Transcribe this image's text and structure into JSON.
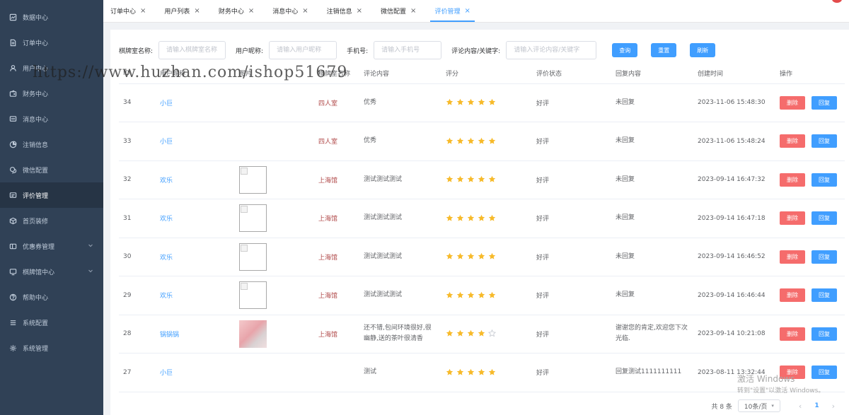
{
  "sidebar": {
    "items": [
      {
        "label": "数据中心",
        "icon": "dashboard-icon"
      },
      {
        "label": "订单中心",
        "icon": "document-icon"
      },
      {
        "label": "用户中心",
        "icon": "user-icon"
      },
      {
        "label": "财务中心",
        "icon": "wallet-icon"
      },
      {
        "label": "消息中心",
        "icon": "message-icon"
      },
      {
        "label": "注销信息",
        "icon": "pie-chart-icon"
      },
      {
        "label": "微信配置",
        "icon": "chat-icon"
      },
      {
        "label": "评价管理",
        "icon": "comment-icon"
      },
      {
        "label": "首页装修",
        "icon": "box-icon"
      },
      {
        "label": "优惠券管理",
        "icon": "coupon-icon"
      },
      {
        "label": "棋牌馆中心",
        "icon": "monitor-icon"
      },
      {
        "label": "帮助中心",
        "icon": "help-icon"
      },
      {
        "label": "系统配置",
        "icon": "list-icon"
      },
      {
        "label": "系统管理",
        "icon": "settings-icon"
      }
    ]
  },
  "tabs": [
    {
      "label": "订单中心"
    },
    {
      "label": "用户列表"
    },
    {
      "label": "财务中心"
    },
    {
      "label": "消息中心"
    },
    {
      "label": "注销信息"
    },
    {
      "label": "微信配置"
    },
    {
      "label": "评价管理"
    }
  ],
  "filters": {
    "room_label": "棋牌室名称:",
    "room_placeholder": "请输入棋牌室名称",
    "nick_label": "用户昵称:",
    "nick_placeholder": "请输入用户昵称",
    "phone_label": "手机号:",
    "phone_placeholder": "请输入手机号",
    "keyword_label": "评论内容/关键字:",
    "keyword_placeholder": "请输入评论内容/关键字",
    "query_btn": "查询",
    "reset_btn": "重置",
    "refresh_btn": "刷新"
  },
  "table": {
    "headers": [
      "ID",
      "用户昵称",
      "图片",
      "棋牌室名称",
      "评论内容",
      "评分",
      "评价状态",
      "回复内容",
      "创建时间",
      "操作"
    ],
    "delete_label": "删除",
    "reply_label": "回复",
    "rows": [
      {
        "id": "34",
        "nick": "小巨",
        "image": "none",
        "room": "四人室",
        "content": "优秀",
        "rating": 5,
        "status": "好评",
        "reply": "未回复",
        "time": "2023-11-06 15:48:30"
      },
      {
        "id": "33",
        "nick": "小巨",
        "image": "none",
        "room": "四人室",
        "content": "优秀",
        "rating": 5,
        "status": "好评",
        "reply": "未回复",
        "time": "2023-11-06 15:48:24"
      },
      {
        "id": "32",
        "nick": "欢乐",
        "image": "broken",
        "room": "上海馆",
        "content": "测试测试测试",
        "rating": 5,
        "status": "好评",
        "reply": "未回复",
        "time": "2023-09-14 16:47:32"
      },
      {
        "id": "31",
        "nick": "欢乐",
        "image": "broken",
        "room": "上海馆",
        "content": "测试测试测试",
        "rating": 5,
        "status": "好评",
        "reply": "未回复",
        "time": "2023-09-14 16:47:18"
      },
      {
        "id": "30",
        "nick": "欢乐",
        "image": "broken",
        "room": "上海馆",
        "content": "测试测试测试",
        "rating": 5,
        "status": "好评",
        "reply": "未回复",
        "time": "2023-09-14 16:46:52"
      },
      {
        "id": "29",
        "nick": "欢乐",
        "image": "broken",
        "room": "上海馆",
        "content": "测试测试测试",
        "rating": 5,
        "status": "好评",
        "reply": "未回复",
        "time": "2023-09-14 16:46:44"
      },
      {
        "id": "28",
        "nick": "锅锅锅",
        "image": "photo",
        "room": "上海馆",
        "content": "还不错,包间环境很好,很幽静,送的茶叶很清香",
        "rating": 4,
        "status": "好评",
        "reply": "谢谢您的肯定,欢迎您下次光临.",
        "time": "2023-09-14 10:21:08"
      },
      {
        "id": "27",
        "nick": "小巨",
        "image": "none",
        "room": "",
        "content": "测试",
        "rating": 5,
        "status": "好评",
        "reply": "回复测试1111111111",
        "time": "2023-08-11 13:32:44"
      }
    ]
  },
  "pagination": {
    "total": "共 8 条",
    "page_size": "10条/页",
    "current_page": "1"
  },
  "overlay": {
    "watermark": "https://www.huzhan.com/ishop51679",
    "activation_title": "激活 Windows",
    "activation_hint": "转到\"设置\"以激活 Windows。"
  },
  "colors": {
    "sidebar_bg": "#304156",
    "primary": "#409eff",
    "danger": "#f56c6c",
    "star": "#f7ba2a"
  }
}
